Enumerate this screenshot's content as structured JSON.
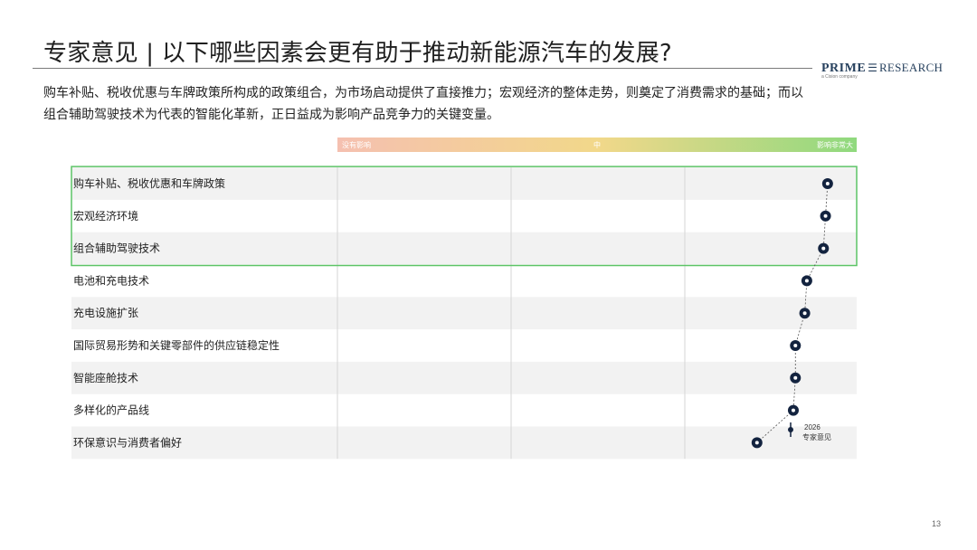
{
  "header": {
    "title": "专家意见 | 以下哪些因素会更有助于推动新能源汽车的发展?",
    "logo_prime": "PRIME",
    "logo_research": "RESEARCH",
    "logo_sub": "a Cision company",
    "logo_mark_icon": "stacked-lines-icon"
  },
  "summary": "购车补贴、税收优惠与车牌政策所构成的政策组合，为市场启动提供了直接推力；宏观经济的整体走势，则奠定了消费需求的基础；而以组合辅助驾驶技术为代表的智能化革新，正日益成为影响产品竞争力的关键变量。",
  "page_number": "13",
  "chart_data": {
    "type": "scatter",
    "scale": {
      "low_label": "没有影响",
      "mid_label": "中",
      "high_label": "影响非常大",
      "gradient_colors": [
        "#f5c0b0",
        "#f2d88a",
        "#8fd97e"
      ]
    },
    "categories": [
      "购车补贴、税收优惠和车牌政策",
      "宏观经济环境",
      "组合辅助驾驶技术",
      "电池和充电技术",
      "充电设施扩张",
      "国际贸易形势和关键零部件的供应链稳定性",
      "智能座舱技术",
      "多样化的产品线",
      "环保意识与消费者偏好"
    ],
    "series": [
      {
        "name": "2026 专家意见",
        "values": [
          4.72,
          4.7,
          4.68,
          4.52,
          4.5,
          4.41,
          4.41,
          4.39,
          4.04
        ]
      }
    ],
    "xlim": [
      0,
      5
    ],
    "highlighted_rows": [
      0,
      1,
      2
    ],
    "legend": {
      "year": "2026",
      "label": "专家意见",
      "position": "bottom-right"
    },
    "colors": {
      "marker": "#13233f",
      "highlight_border": "#5cc466",
      "row_stripe": "#f2f2f2",
      "grid": "#d6d6d6"
    }
  }
}
